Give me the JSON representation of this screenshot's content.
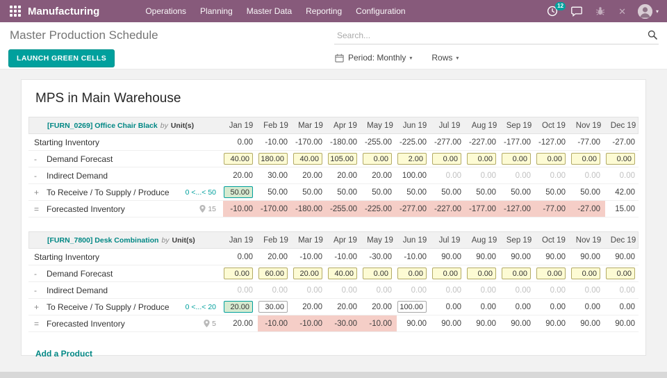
{
  "colors": {
    "brand": "#875A7B",
    "accent": "#00A09D",
    "link": "#008784",
    "badge": "#00A09D",
    "cell-yellow": "#FDFBD4",
    "cell-yellow-border": "#B3AB66",
    "cell-green": "#D6EAD0",
    "cell-green-border": "#00A09D",
    "cell-pink": "#F5CEC7"
  },
  "topbar": {
    "app_title": "Manufacturing",
    "menus": [
      "Operations",
      "Planning",
      "Master Data",
      "Reporting",
      "Configuration"
    ],
    "activity_badge": "12",
    "close_glyph": "✕",
    "caret_glyph": "▾"
  },
  "header": {
    "page_title": "Master Production Schedule",
    "search_placeholder": "Search...",
    "launch_button": "LAUNCH GREEN CELLS",
    "period_label": "Period: Monthly",
    "rows_label": "Rows"
  },
  "main": {
    "title": "MPS in Main Warehouse",
    "add_product": "Add a Product",
    "months": [
      "Jan 19",
      "Feb 19",
      "Mar 19",
      "Apr 19",
      "May 19",
      "Jun 19",
      "Jul 19",
      "Aug 19",
      "Sep 19",
      "Oct 19",
      "Nov 19",
      "Dec 19"
    ],
    "rows": [
      {
        "key": "starting_inventory",
        "op": "",
        "label": "Starting Inventory"
      },
      {
        "key": "demand_forecast",
        "op": "-",
        "label": "Demand Forecast"
      },
      {
        "key": "indirect_demand",
        "op": "-",
        "label": "Indirect Demand"
      },
      {
        "key": "to_receive",
        "op": "+",
        "label": "To Receive / To Supply / Produce"
      },
      {
        "key": "forecasted_inventory",
        "op": "=",
        "label": "Forecasted Inventory"
      }
    ],
    "products": [
      {
        "title": "[FURN_0269] Office Chair Black",
        "by_label": "by",
        "uom": "Unit(s)",
        "supply_hint": "0 <...< 50",
        "pin_count": "15",
        "cells": {
          "starting_inventory": {
            "values": [
              "0.00",
              "-10.00",
              "-170.00",
              "-180.00",
              "-255.00",
              "-225.00",
              "-277.00",
              "-227.00",
              "-177.00",
              "-127.00",
              "-77.00",
              "-27.00"
            ],
            "styles": [
              "p",
              "p",
              "p",
              "p",
              "p",
              "p",
              "p",
              "p",
              "p",
              "p",
              "p",
              "p"
            ]
          },
          "demand_forecast": {
            "values": [
              "40.00",
              "180.00",
              "40.00",
              "105.00",
              "0.00",
              "2.00",
              "0.00",
              "0.00",
              "0.00",
              "0.00",
              "0.00",
              "0.00"
            ],
            "styles": [
              "y",
              "y",
              "y",
              "y",
              "y",
              "y",
              "y",
              "y",
              "y",
              "y",
              "y",
              "y"
            ]
          },
          "indirect_demand": {
            "values": [
              "20.00",
              "30.00",
              "20.00",
              "20.00",
              "20.00",
              "100.00",
              "0.00",
              "0.00",
              "0.00",
              "0.00",
              "0.00",
              "0.00"
            ],
            "styles": [
              "p",
              "p",
              "p",
              "p",
              "p",
              "p",
              "m",
              "m",
              "m",
              "m",
              "m",
              "m"
            ]
          },
          "to_receive": {
            "values": [
              "50.00",
              "50.00",
              "50.00",
              "50.00",
              "50.00",
              "50.00",
              "50.00",
              "50.00",
              "50.00",
              "50.00",
              "50.00",
              "42.00"
            ],
            "styles": [
              "g",
              "p",
              "p",
              "p",
              "p",
              "p",
              "p",
              "p",
              "p",
              "p",
              "p",
              "p"
            ]
          },
          "forecasted_inventory": {
            "values": [
              "-10.00",
              "-170.00",
              "-180.00",
              "-255.00",
              "-225.00",
              "-277.00",
              "-227.00",
              "-177.00",
              "-127.00",
              "-77.00",
              "-27.00",
              "15.00"
            ],
            "styles": [
              "r",
              "r",
              "r",
              "r",
              "r",
              "r",
              "r",
              "r",
              "r",
              "r",
              "r",
              "p"
            ]
          }
        }
      },
      {
        "title": "[FURN_7800] Desk Combination",
        "by_label": "by",
        "uom": "Unit(s)",
        "supply_hint": "0 <...< 20",
        "pin_count": "5",
        "cells": {
          "starting_inventory": {
            "values": [
              "0.00",
              "20.00",
              "-10.00",
              "-10.00",
              "-30.00",
              "-10.00",
              "90.00",
              "90.00",
              "90.00",
              "90.00",
              "90.00",
              "90.00"
            ],
            "styles": [
              "p",
              "p",
              "p",
              "p",
              "p",
              "p",
              "p",
              "p",
              "p",
              "p",
              "p",
              "p"
            ]
          },
          "demand_forecast": {
            "values": [
              "0.00",
              "60.00",
              "20.00",
              "40.00",
              "0.00",
              "0.00",
              "0.00",
              "0.00",
              "0.00",
              "0.00",
              "0.00",
              "0.00"
            ],
            "styles": [
              "y",
              "y",
              "y",
              "y",
              "y",
              "y",
              "y",
              "y",
              "y",
              "y",
              "y",
              "y"
            ]
          },
          "indirect_demand": {
            "values": [
              "0.00",
              "0.00",
              "0.00",
              "0.00",
              "0.00",
              "0.00",
              "0.00",
              "0.00",
              "0.00",
              "0.00",
              "0.00",
              "0.00"
            ],
            "styles": [
              "m",
              "m",
              "m",
              "m",
              "m",
              "m",
              "m",
              "m",
              "m",
              "m",
              "m",
              "m"
            ]
          },
          "to_receive": {
            "values": [
              "20.00",
              "30.00",
              "20.00",
              "20.00",
              "20.00",
              "100.00",
              "0.00",
              "0.00",
              "0.00",
              "0.00",
              "0.00",
              "0.00"
            ],
            "styles": [
              "g",
              "w",
              "p",
              "p",
              "p",
              "w",
              "p",
              "p",
              "p",
              "p",
              "p",
              "p"
            ]
          },
          "forecasted_inventory": {
            "values": [
              "20.00",
              "-10.00",
              "-10.00",
              "-30.00",
              "-10.00",
              "90.00",
              "90.00",
              "90.00",
              "90.00",
              "90.00",
              "90.00",
              "90.00"
            ],
            "styles": [
              "p",
              "r",
              "r",
              "r",
              "r",
              "p",
              "p",
              "p",
              "p",
              "p",
              "p",
              "p"
            ]
          }
        }
      }
    ]
  }
}
